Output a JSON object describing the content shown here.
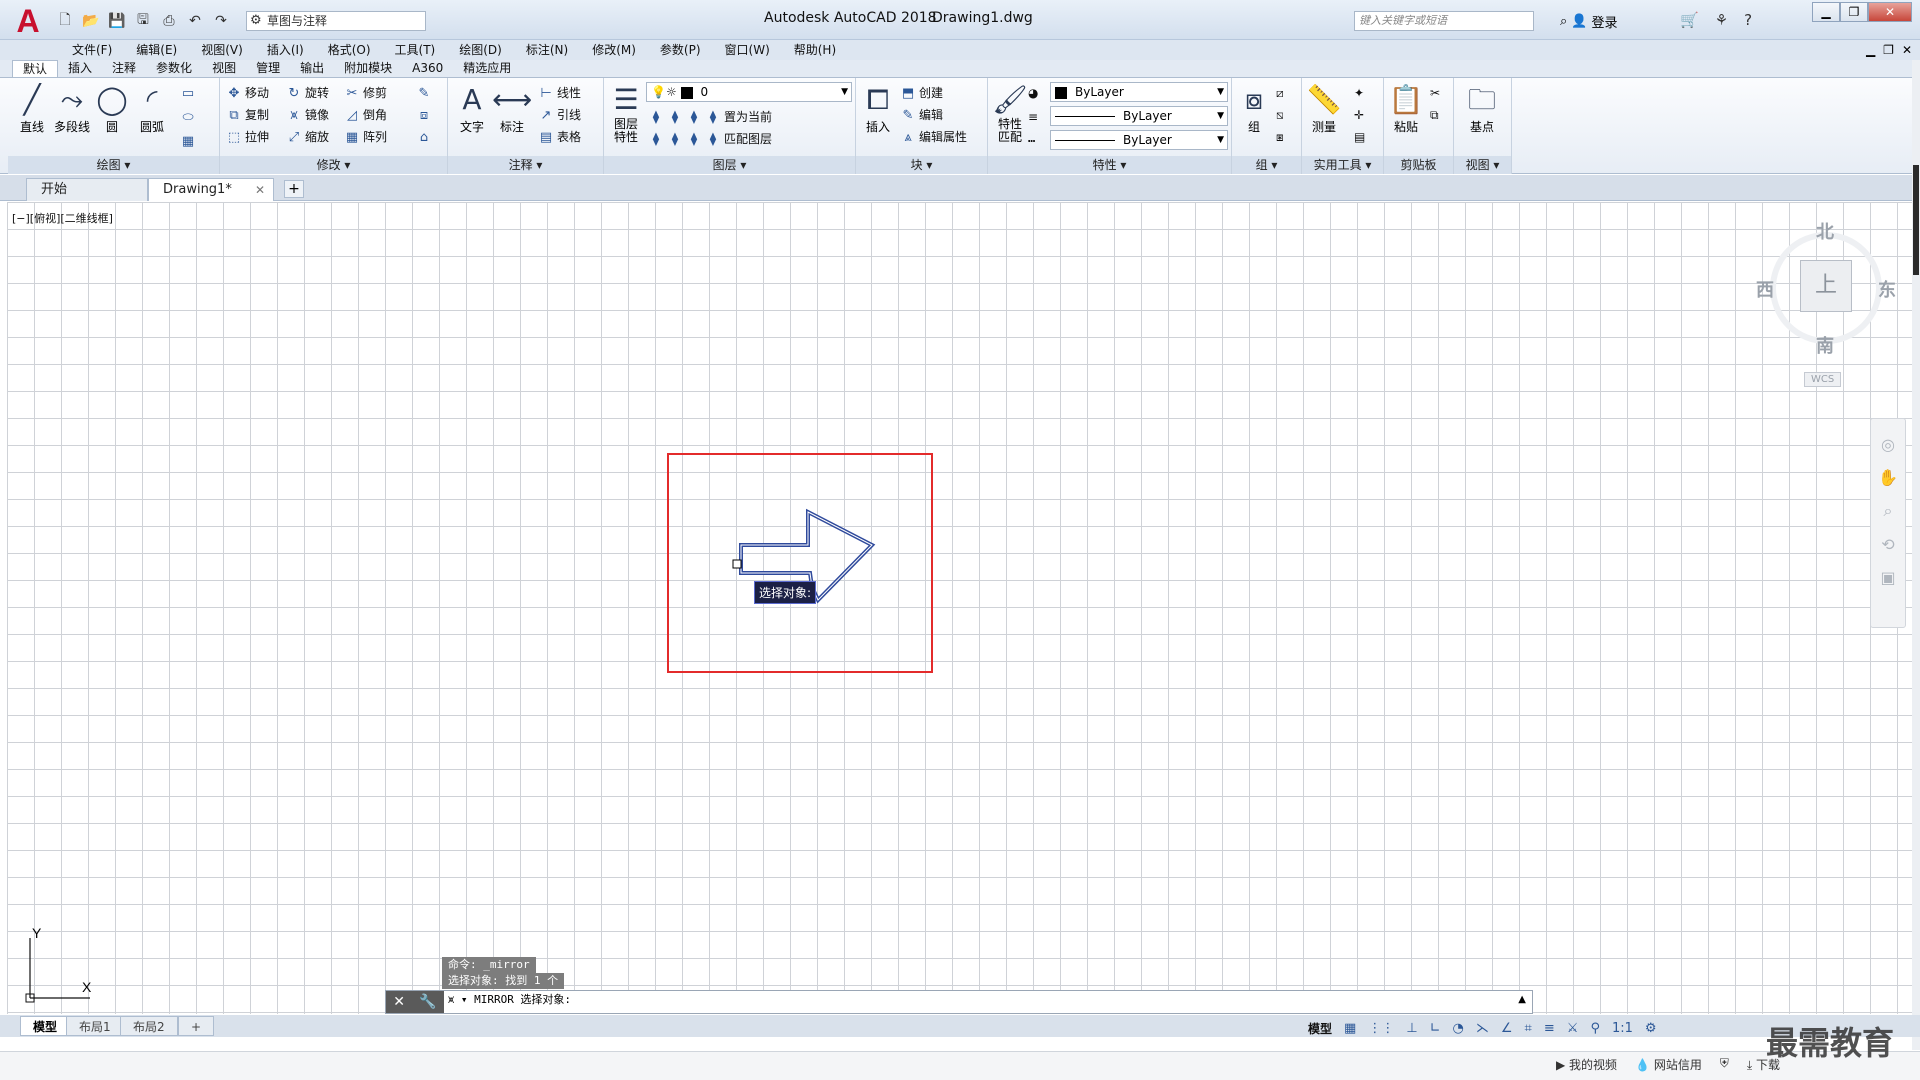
{
  "app": {
    "title": "Autodesk AutoCAD 2018",
    "file": "Drawing1.dwg",
    "logo": "A",
    "workspace": "草图与注释",
    "search_placeholder": "键入关键字或短语",
    "signin": "登录"
  },
  "menu": [
    "文件(F)",
    "编辑(E)",
    "视图(V)",
    "插入(I)",
    "格式(O)",
    "工具(T)",
    "绘图(D)",
    "标注(N)",
    "修改(M)",
    "参数(P)",
    "窗口(W)",
    "帮助(H)"
  ],
  "ribbon_tabs": [
    "默认",
    "插入",
    "注释",
    "参数化",
    "视图",
    "管理",
    "输出",
    "附加模块",
    "A360",
    "精选应用"
  ],
  "ribbon": {
    "draw": {
      "title": "绘图 ▾",
      "line": "直线",
      "polyline": "多段线",
      "circle": "圆",
      "arc": "圆弧"
    },
    "modify": {
      "title": "修改 ▾",
      "move": "移动",
      "rotate": "旋转",
      "trim": "修剪",
      "copy": "复制",
      "mirror": "镜像",
      "fillet": "倒角",
      "stretch": "拉伸",
      "scale": "缩放",
      "array": "阵列"
    },
    "annotation": {
      "title": "注释 ▾",
      "text": "文字",
      "dimension": "标注",
      "linear": "线性",
      "leader": "引线",
      "table": "表格"
    },
    "layers": {
      "title": "图层 ▾",
      "props": "图层\n特性",
      "current_layer": "0",
      "make_current": "置为当前",
      "match_layer": "匹配图层"
    },
    "block": {
      "title": "块 ▾",
      "insert": "插入",
      "create": "创建",
      "edit": "编辑",
      "edit_attr": "编辑属性"
    },
    "properties": {
      "title": "特性 ▾",
      "match": "特性\n匹配",
      "color": "ByLayer",
      "lineweight": "ByLayer",
      "linetype": "ByLayer"
    },
    "groups": {
      "title": "组 ▾",
      "group": "组"
    },
    "utilities": {
      "title": "实用工具 ▾",
      "measure": "测量"
    },
    "clipboard": {
      "title": "剪贴板",
      "paste": "粘贴"
    },
    "view": {
      "title": "视图 ▾",
      "base": "基点"
    }
  },
  "file_tabs": {
    "start": "开始",
    "drawing": "Drawing1*"
  },
  "viewport_label": "[−][俯视][二维线框]",
  "viewcube": {
    "north": "北",
    "south": "南",
    "east": "东",
    "west": "西",
    "face": "上",
    "wcs": "WCS"
  },
  "tooltip": "选择对象:",
  "command": {
    "history": [
      "命令: _mirror",
      "选择对象: 找到 1 个"
    ],
    "prompt": "MIRROR 选择对象:"
  },
  "ucs": {
    "x": "X",
    "y": "Y"
  },
  "layout_tabs": [
    "模型",
    "布局1",
    "布局2"
  ],
  "status": {
    "model": "模型",
    "scale": "1:1"
  },
  "bottom": [
    "我的视频",
    "网站信用",
    "下载"
  ],
  "watermark": "最需教育",
  "colors": {
    "highlight": "#e32b2b",
    "object": "#2f4a9c",
    "tooltip_bg": "#1b2045"
  }
}
